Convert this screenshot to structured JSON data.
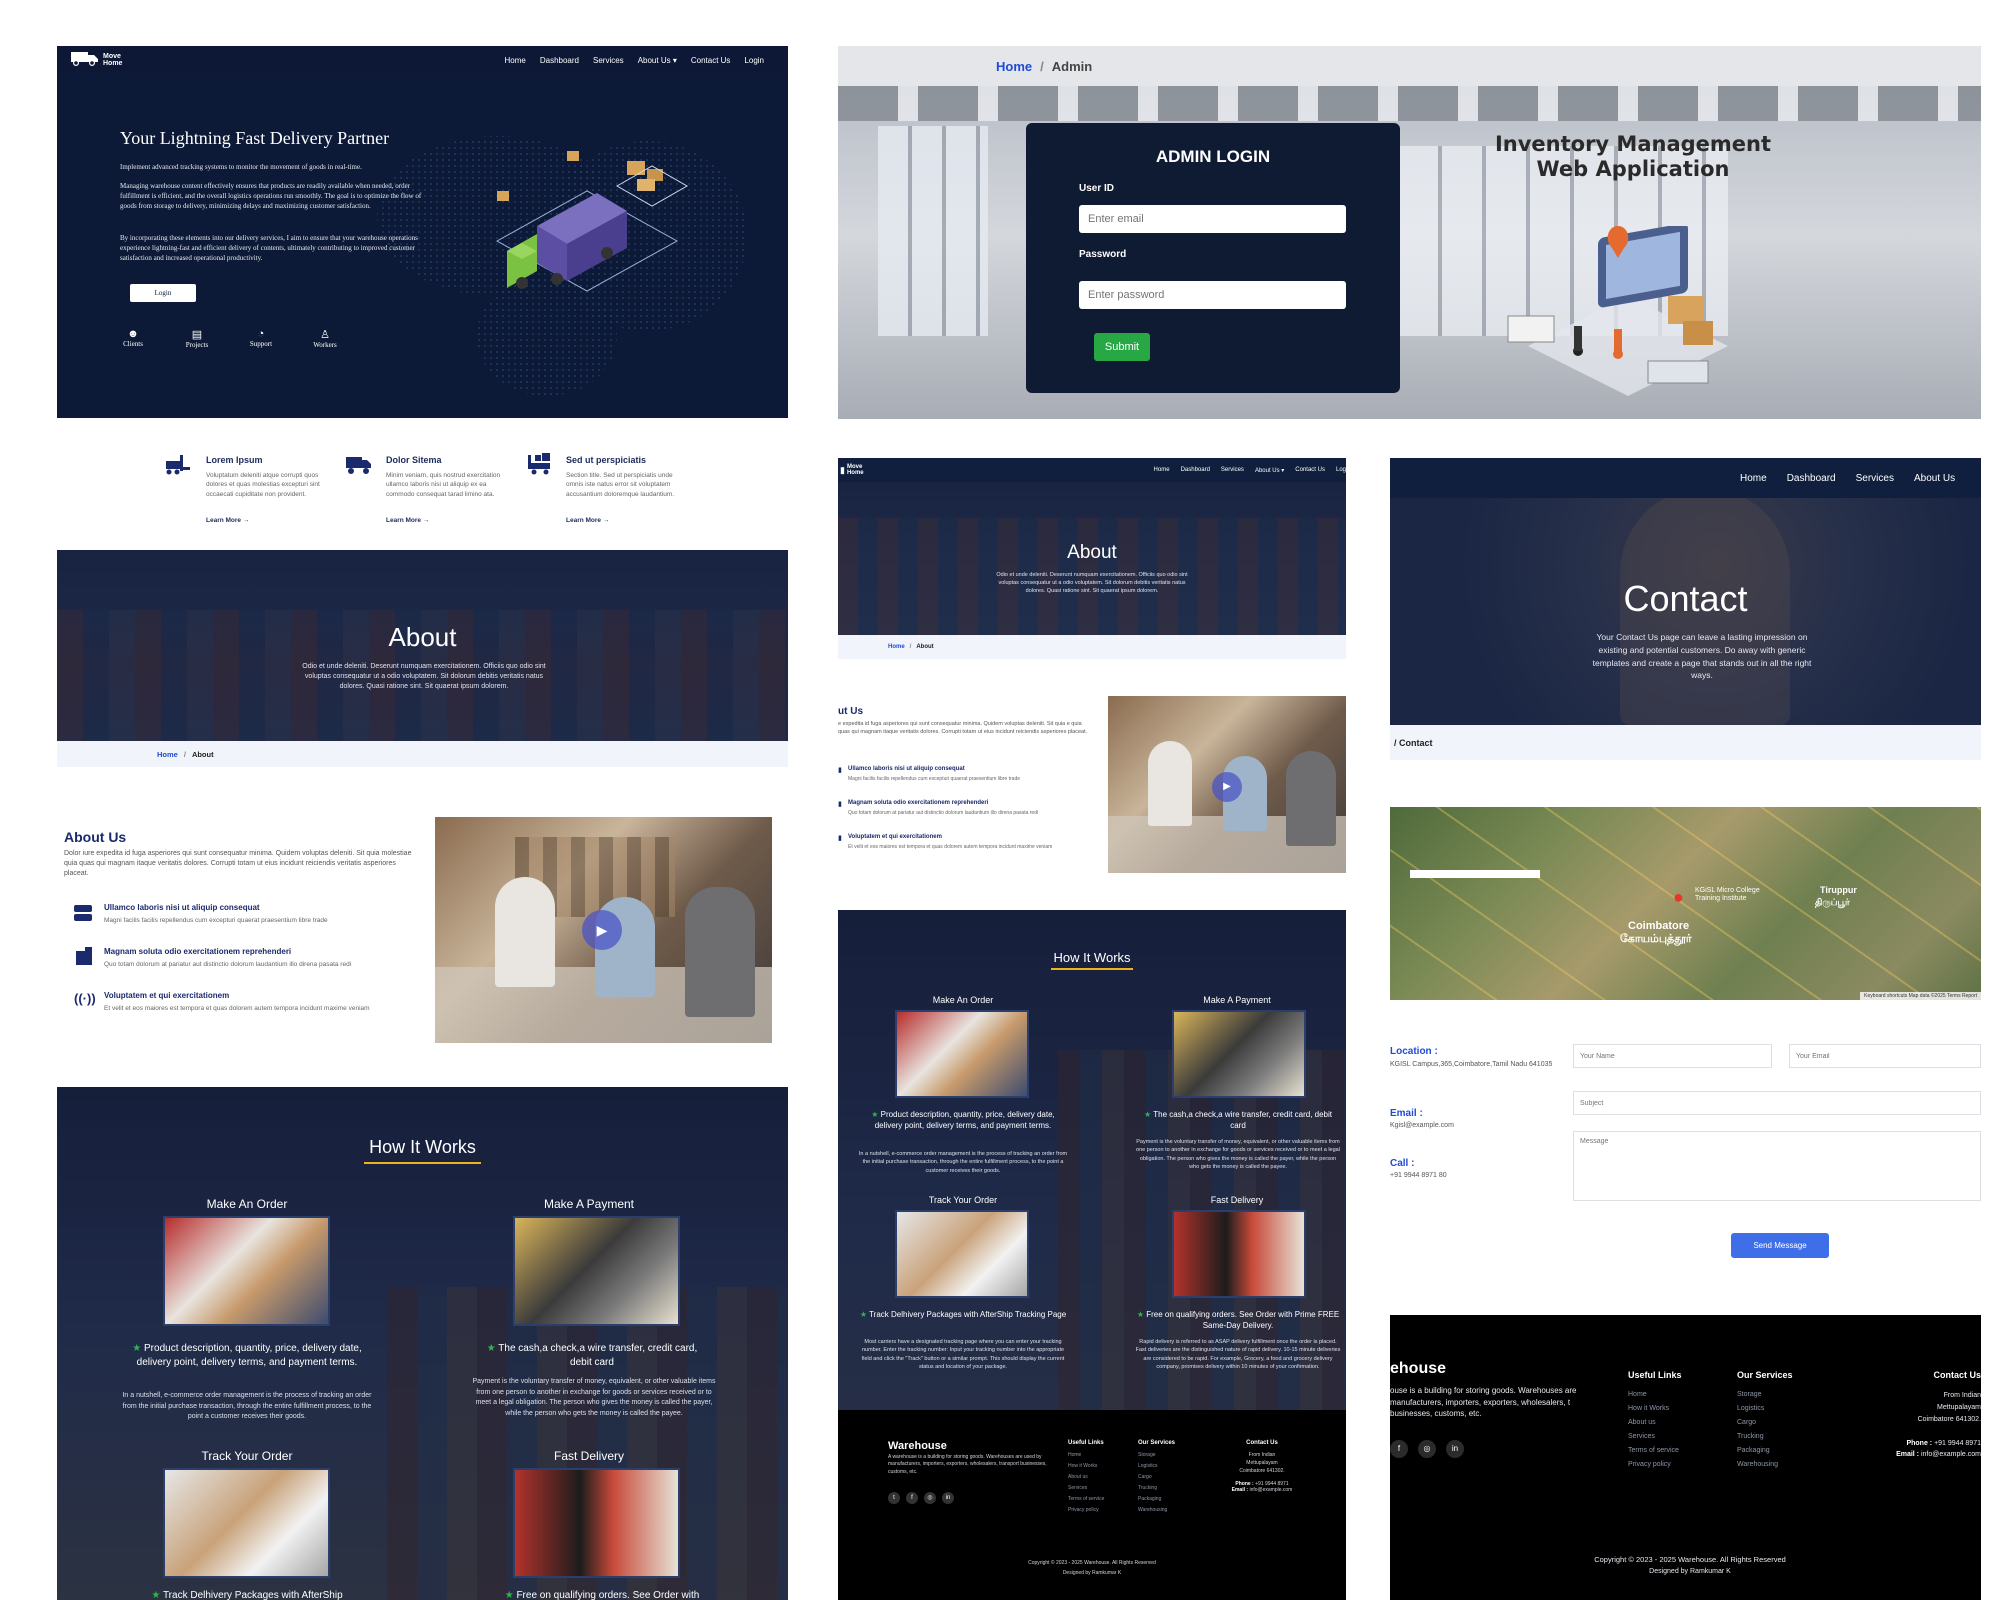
{
  "colors": {
    "navy": "#0f1f3d",
    "gold": "#f0b21b",
    "blue_link": "#1f4bd6",
    "green_submit": "#28a745",
    "send_blue": "#3f6fe8",
    "footer_bg": "#000000"
  },
  "hero": {
    "brand": "Move Home",
    "nav": [
      "Home",
      "Dashboard",
      "Services",
      "About Us ▾",
      "Contact Us",
      "Login"
    ],
    "title": "Your Lightning Fast Delivery Partner",
    "p1": "Implement advanced tracking systems to monitor the movement of goods in real-time.",
    "p2": "Managing warehouse content effectively ensures that products are readily available when needed, order fulfillment is efficient, and the overall logistics operations run smoothly. The goal is to optimize the flow of goods from storage to delivery, minimizing delays and maximizing customer satisfaction.",
    "p3": "By incorporating these elements into our delivery services, I aim to ensure that your warehouse operations experience lightning-fast and efficient delivery of contents, ultimately contributing to improved customer satisfaction and increased operational productivity.",
    "login_button": "Login",
    "stats": [
      {
        "icon": "clients-icon",
        "label": "Clients"
      },
      {
        "icon": "projects-icon",
        "label": "Projects"
      },
      {
        "icon": "support-icon",
        "label": "Support"
      },
      {
        "icon": "workers-icon",
        "label": "Workers"
      }
    ]
  },
  "features": [
    {
      "icon": "forklift-icon",
      "title": "Lorem Ipsum",
      "text": "Voluptatum deleniti atque corrupti quos dolores et quas molestias excepturi sint occaecati cupiditate non provident.",
      "link": "Learn More"
    },
    {
      "icon": "truck-icon",
      "title": "Dolor Sitema",
      "text": "Minim veniam, quis nostrud exercitation ullamco laboris nisi ut aliquip ex ea commodo consequat tarad limino ata.",
      "link": "Learn More"
    },
    {
      "icon": "shipping-icon",
      "title": "Sed ut perspiciatis",
      "text": "Section title. Sed ut perspiciatis unde omnis iste natus error sit voluptatem accusantium doloremque laudantium.",
      "link": "Learn More"
    }
  ],
  "about": {
    "title": "About",
    "text": "Odio et unde deleniti. Deserunt numquam exercitationem. Officiis quo odio sint voluptas consequatur ut a odio voluptatem. Sit dolorum debitis veritatis natus dolores. Quasi ratione sint. Sit quaerat ipsum dolorem.",
    "crumb_home": "Home",
    "crumb_sep": "/",
    "crumb_current": "About",
    "us_title": "About Us",
    "us_text": "Dolor iure expedita id fuga asperiores qui sunt consequatur minima. Quidem voluptas deleniti. Sit quia molestiae quia quas qui magnam itaque veritatis dolores. Corrupti totam ut eius incidunt reiciendis veritatis asperiores placeat.",
    "items": [
      {
        "icon": "stack-icon",
        "title": "Ullamco laboris nisi ut aliquip consequat",
        "text": "Magni facilis facilis repellendus cum excepturi quaerat praesentium libre trade"
      },
      {
        "icon": "building-icon",
        "title": "Magnam soluta odio exercitationem reprehenderi",
        "text": "Quo totam dolorum at pariatur aut distinctio dolorum laudantium illo direna pasata redi"
      },
      {
        "icon": "broadcast-icon",
        "title": "Voluptatem et qui exercitationem",
        "text": "Et velit et eos maiores est tempora et quas dolorem autem tempora incidunt maxime veniam"
      }
    ],
    "small_title": "ut Us",
    "small_text": "e expedita id fuga asperiores qui sunt consequatur minima. Quidem voluptas deleniti. Sit quia e quia quas qui magnam itaque veritatis dolores. Corrupti totam ut eius incidunt reiciendis asperiores placeat."
  },
  "how": {
    "title": "How It Works",
    "steps": [
      {
        "title": "Make An Order",
        "head": "Product description, quantity, price, delivery date, delivery point, delivery terms, and payment terms.",
        "text": "In a nutshell, e-commerce order management is the process of tracking an order from the initial purchase transaction, through the entire fulfillment process, to the point a customer receives their goods."
      },
      {
        "title": "Make A Payment",
        "head": "The cash,a check,a wire transfer, credit card, debit card",
        "text": "Payment is the voluntary transfer of money, equivalent, or other valuable items from one person to another in exchange for goods or services received or to meet a legal obligation. The person who gives the money is called the payer, while the person who gets the money is called the payee."
      },
      {
        "title": "Track Your Order",
        "head": "Track Delhivery Packages with AfterShip Tracking Page",
        "text": "Most carriers have a designated tracking page where you can enter your tracking number. Enter the tracking number: Input your tracking number into the appropriate field and click the \"Track\" button or a similar prompt. This should display the current status and location of your package."
      },
      {
        "title": "Fast Delivery",
        "head": "Free on qualifying orders. See Order with Prime FREE Same-Day Delivery.",
        "text": "Rapid delivery is referred to as ASAP delivery fulfillment once the order is placed. Fast deliveries are the distinguished nature of rapid delivery. 10-15 minute deliveries are considered to be rapid. For example, Grocery, a food and grocery delivery company, promises delivery within 10 minutes of your confirmation."
      }
    ],
    "large_bottom_1": "Track Delhivery Packages with AfterShip",
    "large_bottom_2": "Free on qualifying orders. See Order with"
  },
  "admin": {
    "crumb_home": "Home",
    "crumb_sep": "/",
    "crumb_current": "Admin",
    "card_title": "ADMIN LOGIN",
    "userid_label": "User ID",
    "email_placeholder": "Enter email",
    "password_label": "Password",
    "password_placeholder": "Enter password",
    "submit": "Submit",
    "heading_line1": "Inventory Management",
    "heading_line2": "Web Application"
  },
  "mid_nav": {
    "brand": "Move Home",
    "links": [
      "Home",
      "Dashboard",
      "Services",
      "About Us ▾",
      "Contact Us",
      "Log"
    ]
  },
  "contact": {
    "nav": [
      "Home",
      "Dashboard",
      "Services",
      "About Us"
    ],
    "title": "Contact",
    "text": "Your Contact Us page can leave a lasting impression on existing and potential customers. Do away with generic templates and create a page that stands out in all the right ways.",
    "crumb": "/  Contact",
    "location_label": "Location :",
    "location_value": "KGISL Campus,365,Coimbatore,Tamil Nadu 641035",
    "email_label": "Email :",
    "email_value": "Kgisl@example.com",
    "call_label": "Call :",
    "call_value": "+91 9944 8971 80",
    "name_placeholder": "Your Name",
    "email_placeholder": "Your Email",
    "subject_placeholder": "Subject",
    "message_placeholder": "Message",
    "send": "Send Message",
    "map_city": "Coimbatore",
    "map_city_tamil": "கோயம்புத்தூர்",
    "map_marker": "KGiSL Micro College Training Institute",
    "map_town": "Tiruppur",
    "map_town_tamil": "திருப்பூர்",
    "map_attrib": "Keyboard shortcuts   Map data ©2025   Terms   Report"
  },
  "footer": {
    "brand": "Warehouse",
    "brand_partial": "ehouse",
    "desc": "A warehouse is a building for storing goods. Warehouses are used by manufacturers, importers, exporters, wholesalers, transport businesses, customs, etc.",
    "desc_partial": "ouse is a building for storing goods. Warehouses are manufacturers, importers, exporters, wholesalers, t businesses, customs, etc.",
    "useful_title": "Useful Links",
    "useful": [
      "Home",
      "How it Works",
      "About us",
      "Services",
      "Terms of service",
      "Privacy policy"
    ],
    "services_title": "Our Services",
    "services": [
      "Storage",
      "Logistics",
      "Cargo",
      "Trucking",
      "Packaging",
      "Warehousing"
    ],
    "contact_title": "Contact Us",
    "contact_lines": [
      "From Indian",
      "Mettupalayam",
      "Coimbatore 641302."
    ],
    "phone_label": "Phone :",
    "phone": "+91 9944 8971",
    "email_label": "Email :",
    "email": "info@example.com",
    "copyright": "Copyright © 2023 - 2025 Warehouse. All Rights Reserved",
    "designed": "Designed by Ramkumar K",
    "socials": [
      "twitter-icon",
      "facebook-icon",
      "instagram-icon",
      "linkedin-icon"
    ]
  }
}
